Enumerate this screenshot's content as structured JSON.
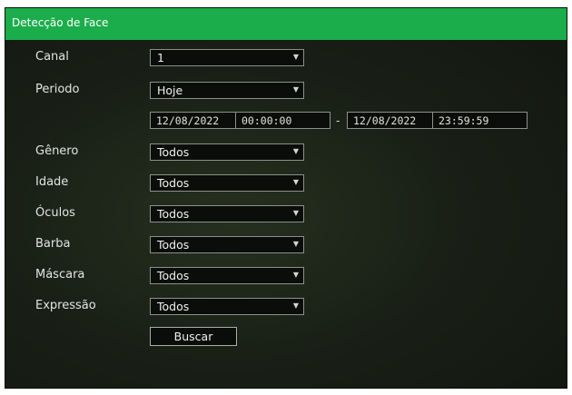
{
  "window": {
    "title": "Detecção de Face"
  },
  "form": {
    "canal": {
      "label": "Canal",
      "value": "1"
    },
    "periodo": {
      "label": "Periodo",
      "value": "Hoje"
    },
    "range": {
      "start_date": "12/08/2022",
      "start_time": "00:00:00",
      "separator": "-",
      "end_date": "12/08/2022",
      "end_time": "23:59:59"
    },
    "genero": {
      "label": "Gênero",
      "value": "Todos"
    },
    "idade": {
      "label": "Idade",
      "value": "Todos"
    },
    "oculos": {
      "label": "Óculos",
      "value": "Todos"
    },
    "barba": {
      "label": "Barba",
      "value": "Todos"
    },
    "mascara": {
      "label": "Máscara",
      "value": "Todos"
    },
    "expressao": {
      "label": "Expressão",
      "value": "Todos"
    },
    "search_button": "Buscar"
  },
  "colors": {
    "accent": "#1bad4b",
    "dropdown_icon": "caret-down-icon"
  }
}
